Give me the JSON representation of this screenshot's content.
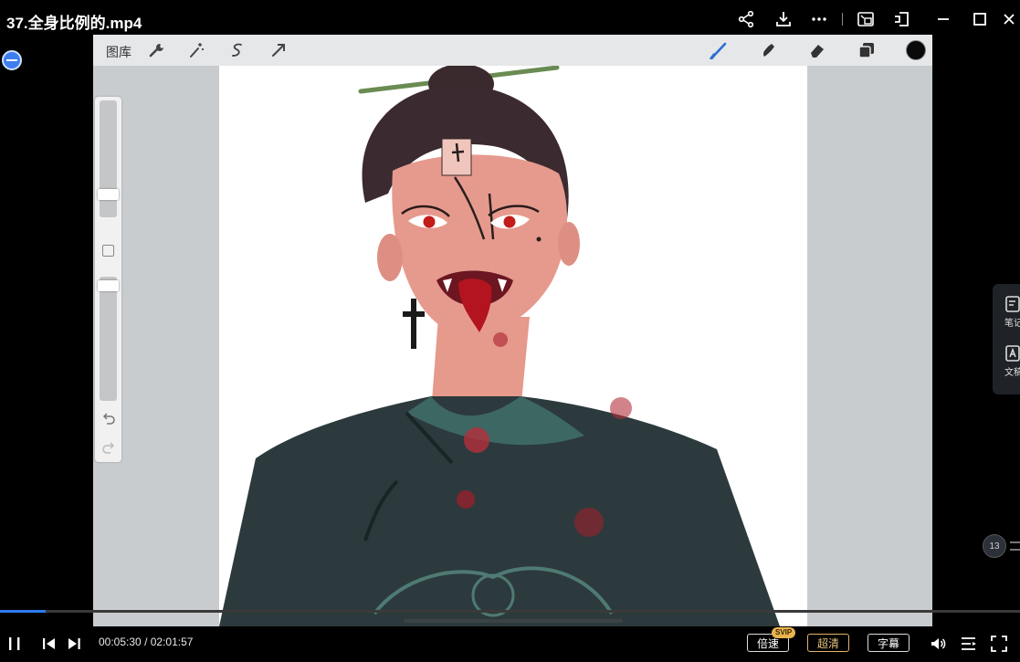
{
  "window": {
    "title": "37.全身比例的.mp4"
  },
  "titlebar_icons": [
    "share-icon",
    "download-icon",
    "more-icon",
    "picture-in-picture-icon",
    "pin-window-icon",
    "minimize-icon",
    "maximize-icon",
    "close-icon"
  ],
  "procreate": {
    "gallery_label": "图库",
    "tools_left": [
      "wrench-icon",
      "magic-wand-icon",
      "selection-icon",
      "transform-arrow-icon"
    ],
    "tools_right": [
      "brush-icon",
      "smudge-icon",
      "eraser-icon",
      "layers-icon"
    ],
    "current_color": "#0a0a0a",
    "brush_size_level": 0.2,
    "opacity_level": 0.95
  },
  "right_panel": {
    "notes_label": "笔记",
    "docs_label": "文稿"
  },
  "speed_widget": {
    "value": "13"
  },
  "playback": {
    "current_time": "00:05:30",
    "separator": "/",
    "total_time": "02:01:57",
    "progress_fraction": 0.045,
    "speed_label": "倍速",
    "svip_label": "SVIP",
    "quality_label": "超清",
    "subtitle_label": "字幕"
  },
  "colors": {
    "accent_blue": "#2f7bf0",
    "brush_blue": "#2b6fd6",
    "quality_gold": "#e8c27e",
    "svip_gold": "#e9b44f"
  }
}
